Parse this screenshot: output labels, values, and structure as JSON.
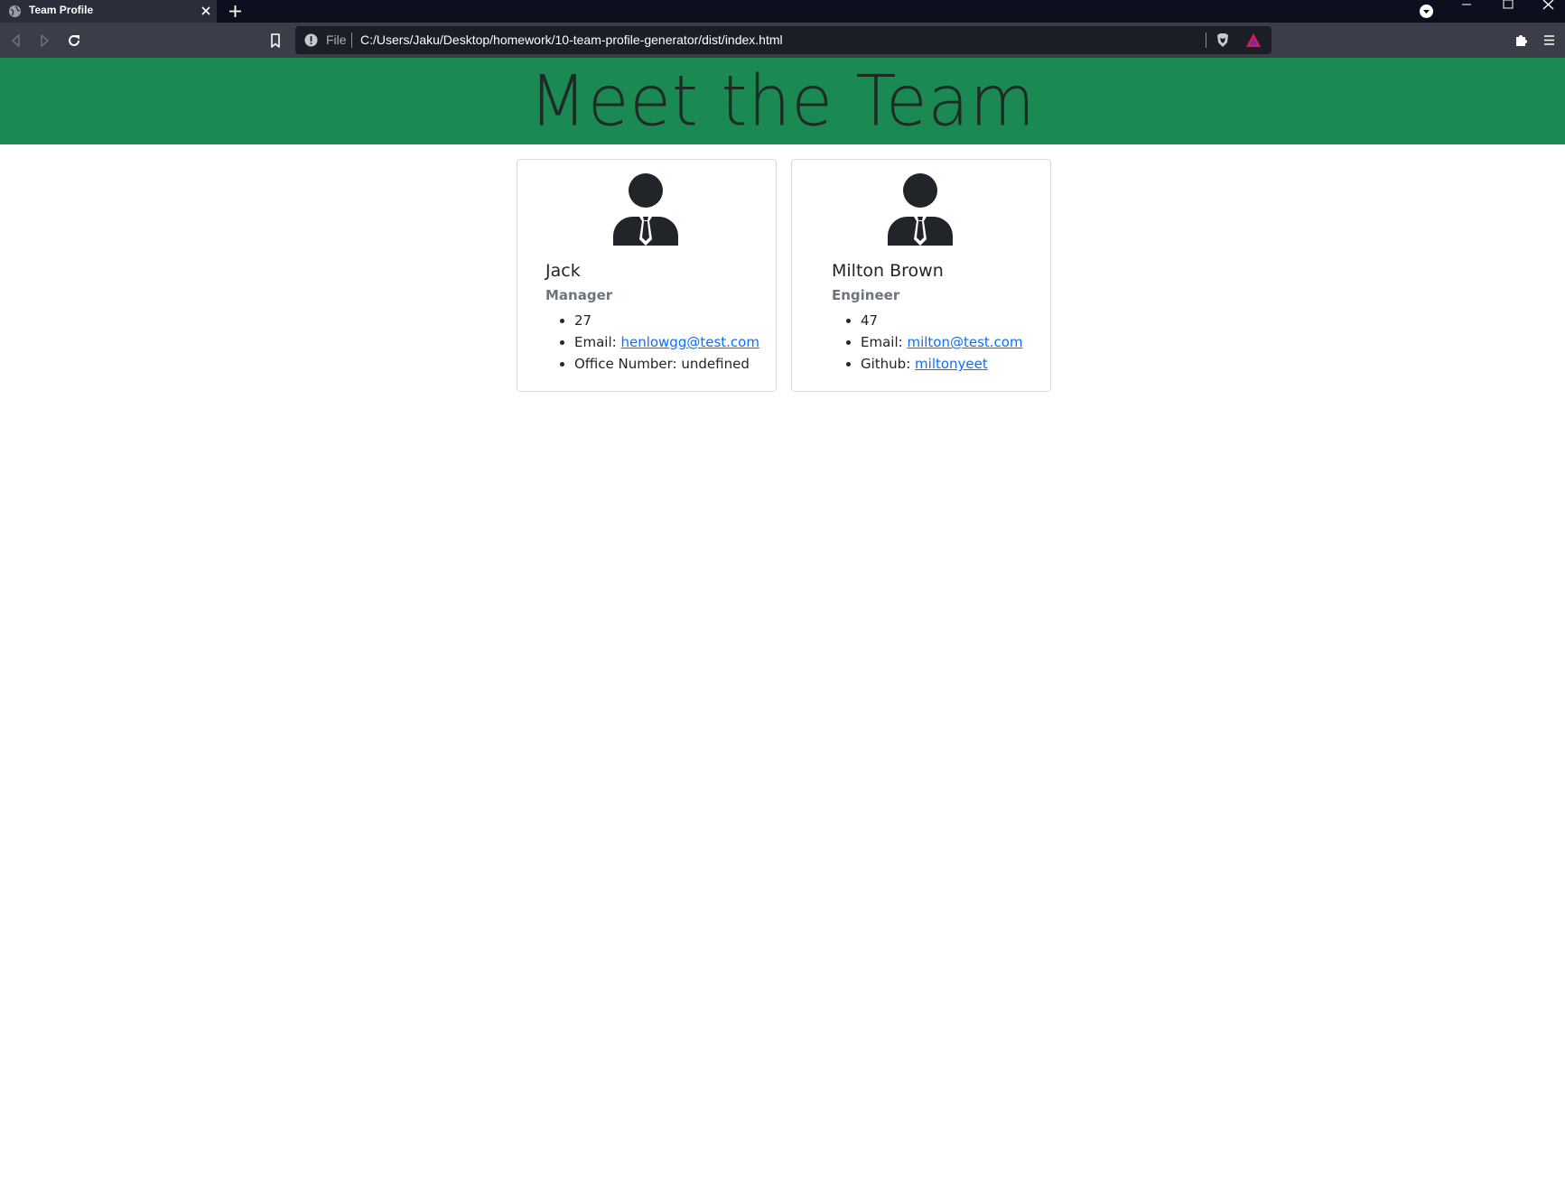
{
  "browser": {
    "tab_title": "Team Profile",
    "scheme_label": "File",
    "url": "C:/Users/Jaku/Desktop/homework/10-team-profile-generator/dist/index.html",
    "chrome_color": "#3b3d49"
  },
  "page": {
    "heading": "Meet the Team",
    "header_color": "#1a8a52"
  },
  "team": [
    {
      "name": "Jack",
      "role": "Manager",
      "id": "27",
      "email_label": "Email:",
      "email": "henlowgg@test.com",
      "extra_label": "Office Number:",
      "extra_value": "undefined"
    },
    {
      "name": "Milton Brown",
      "role": "Engineer",
      "id": "47",
      "email_label": "Email:",
      "email": "milton@test.com",
      "extra_label": "Github:",
      "extra_value": "miltonyeet"
    }
  ],
  "icons": {
    "card_avatar": "user-tie-icon",
    "favicon": "globe-icon"
  }
}
